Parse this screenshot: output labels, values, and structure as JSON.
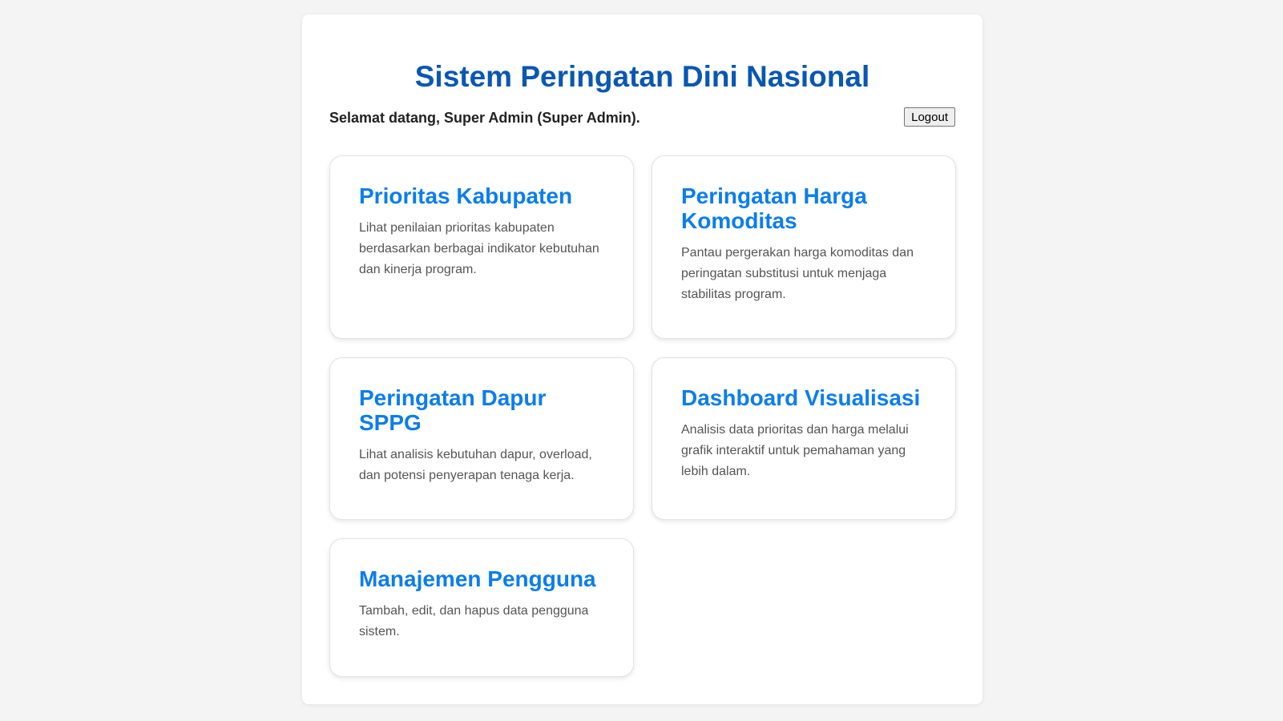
{
  "header": {
    "title": "Sistem Peringatan Dini Nasional",
    "welcome": "Selamat datang, Super Admin (Super Admin).",
    "logout_label": "Logout"
  },
  "cards": [
    {
      "title": "Prioritas Kabupaten",
      "description": "Lihat penilaian prioritas kabupaten berdasarkan berbagai indikator kebutuhan dan kinerja program."
    },
    {
      "title": "Peringatan Harga Komoditas",
      "description": "Pantau pergerakan harga komoditas dan peringatan substitusi untuk menjaga stabilitas program."
    },
    {
      "title": "Peringatan Dapur SPPG",
      "description": "Lihat analisis kebutuhan dapur, overload, dan potensi penyerapan tenaga kerja."
    },
    {
      "title": "Dashboard Visualisasi",
      "description": "Analisis data prioritas dan harga melalui grafik interaktif untuk pemahaman yang lebih dalam."
    },
    {
      "title": "Manajemen Pengguna",
      "description": "Tambah, edit, dan hapus data pengguna sistem."
    }
  ]
}
